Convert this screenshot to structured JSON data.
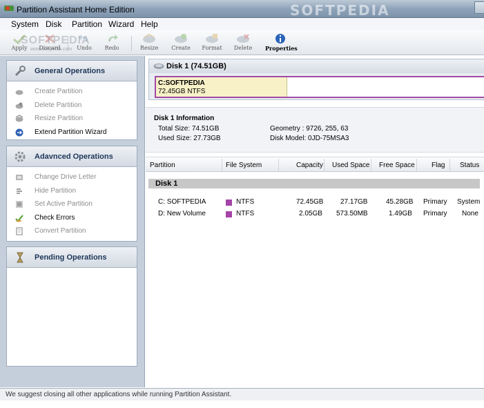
{
  "window": {
    "title": "Partition Assistant Home Edition",
    "watermark": "SOFTPEDIA"
  },
  "menu": {
    "items": [
      "System",
      "Disk",
      "Partition",
      "Wizard",
      "Help"
    ]
  },
  "toolbar": {
    "watermark": "SOFTPEDIA",
    "watermark_sub": "www.softpedia.com",
    "buttons": [
      {
        "label": "Apply",
        "icon": "apply-icon"
      },
      {
        "label": "Discard",
        "icon": "discard-icon"
      },
      {
        "label": "Undo",
        "icon": "undo-icon"
      },
      {
        "label": "Redo",
        "icon": "redo-icon"
      },
      {
        "label": "Resize",
        "icon": "resize-icon"
      },
      {
        "label": "Create",
        "icon": "create-icon"
      },
      {
        "label": "Format",
        "icon": "format-icon"
      },
      {
        "label": "Delete",
        "icon": "delete-icon"
      },
      {
        "label": "Properties",
        "icon": "properties-icon"
      }
    ]
  },
  "sidebar": {
    "general": {
      "title": "General Operations",
      "items": [
        {
          "label": "Create Partition",
          "enabled": false
        },
        {
          "label": "Delete Partition",
          "enabled": false
        },
        {
          "label": "Resize Partition",
          "enabled": false
        },
        {
          "label": "Extend Partition Wizard",
          "enabled": true
        }
      ]
    },
    "advanced": {
      "title": "Adavnced Operations",
      "items": [
        {
          "label": "Change Drive Letter",
          "enabled": false
        },
        {
          "label": "Hide Partition",
          "enabled": false
        },
        {
          "label": "Set Active Partition",
          "enabled": false
        },
        {
          "label": "Check Errors",
          "enabled": true
        },
        {
          "label": "Convert Partition",
          "enabled": false
        }
      ]
    },
    "pending": {
      "title": "Pending Operations"
    }
  },
  "disk_map": {
    "title": "Disk 1 (74.51GB)",
    "partition_name": "C:SOFTPEDIA",
    "partition_detail": "72.45GB NTFS"
  },
  "disk_info": {
    "title": "Disk 1 Information",
    "total_size": "Total Size: 74.51GB",
    "used_size": "Used  Size: 27.73GB",
    "geometry": "Geometry : 9726, 255, 63",
    "model": "Disk Model: 0JD-75MSA3"
  },
  "table": {
    "headers": [
      "Partition",
      "File System",
      "Capacity",
      "Used Space",
      "Free Space",
      "Flag",
      "Status"
    ],
    "group": "Disk 1",
    "rows": [
      {
        "partition": "C:  SOFTPEDIA",
        "fs": "NTFS",
        "capacity": "72.45GB",
        "used": "27.17GB",
        "free": "45.28GB",
        "flag": "Primary",
        "status": "System"
      },
      {
        "partition": "D:  New Volume",
        "fs": "NTFS",
        "capacity": "2.05GB",
        "used": "573.50MB",
        "free": "1.49GB",
        "flag": "Primary",
        "status": "None"
      }
    ]
  },
  "status": {
    "text": "We suggest closing all other applications while running Partition Assistant."
  },
  "colors": {
    "ntfs": "#a543a8",
    "group_header_text": "#1e3658",
    "sidebar_bg": "#c5cfdc"
  }
}
